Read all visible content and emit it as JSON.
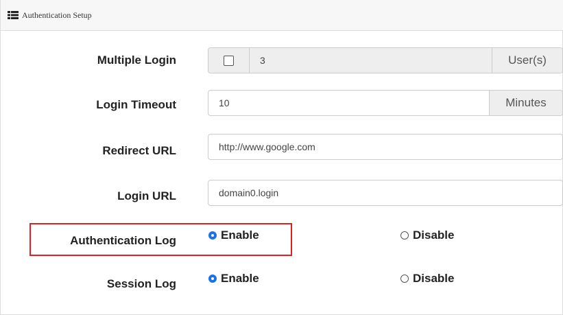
{
  "panel": {
    "title": "Authentication Setup",
    "icon": "list-icon"
  },
  "multiple_login": {
    "label": "Multiple Login",
    "checked": false,
    "value": "3",
    "unit": "User(s)"
  },
  "login_timeout": {
    "label": "Login Timeout",
    "value": "10",
    "unit": "Minutes"
  },
  "redirect_url": {
    "label": "Redirect URL",
    "value": "http://www.google.com"
  },
  "login_url": {
    "label": "Login URL",
    "value": "domain0.login"
  },
  "authentication_log": {
    "label": "Authentication Log",
    "enable_label": "Enable",
    "disable_label": "Disable",
    "selected": "Enable"
  },
  "session_log": {
    "label": "Session Log",
    "enable_label": "Enable",
    "disable_label": "Disable",
    "selected": "Enable"
  },
  "colors": {
    "accent": "#1a73e8",
    "highlight": "#e02020",
    "addon_bg": "#eeeeee"
  }
}
